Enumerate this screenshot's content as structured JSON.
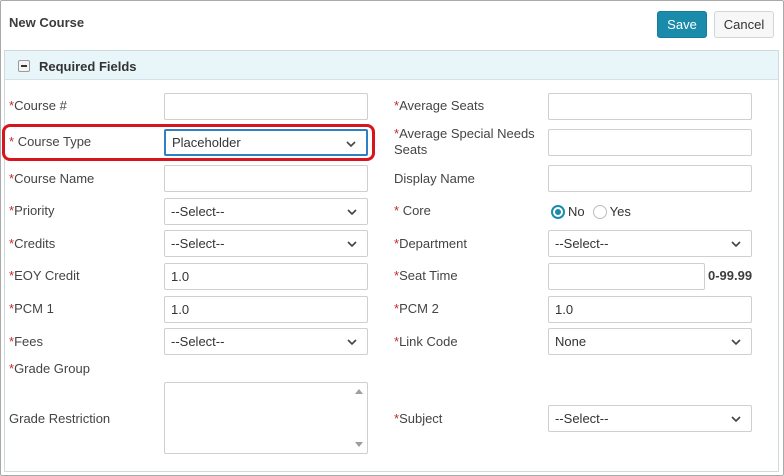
{
  "header": {
    "title": "New Course",
    "save_label": "Save",
    "cancel_label": "Cancel"
  },
  "section": {
    "title": "Required Fields"
  },
  "fields": {
    "course_number": {
      "label": "Course #",
      "value": ""
    },
    "course_type": {
      "label": "Course Type",
      "value": "Placeholder"
    },
    "course_name": {
      "label": "Course Name",
      "value": ""
    },
    "priority": {
      "label": "Priority",
      "value": "--Select--"
    },
    "credits": {
      "label": "Credits",
      "value": "--Select--"
    },
    "eoy_credit": {
      "label": "EOY Credit",
      "value": "1.0"
    },
    "pcm1": {
      "label": "PCM 1",
      "value": "1.0"
    },
    "fees": {
      "label": "Fees",
      "value": "--Select--"
    },
    "grade_group": {
      "label": "Grade Group"
    },
    "grade_restriction": {
      "label": "Grade Restriction",
      "value": ""
    },
    "average_seats": {
      "label": "Average Seats",
      "value": ""
    },
    "average_special_needs_seats": {
      "label_line1": "Average Special Needs",
      "label_line2": "Seats",
      "value": ""
    },
    "display_name": {
      "label": "Display Name",
      "value": ""
    },
    "core": {
      "label": "Core",
      "options": [
        "No",
        "Yes"
      ],
      "selected": "No"
    },
    "department": {
      "label": "Department",
      "value": "--Select--"
    },
    "seat_time": {
      "label": "Seat Time",
      "value": "",
      "hint": "0-99.99"
    },
    "pcm2": {
      "label": "PCM 2",
      "value": "1.0"
    },
    "link_code": {
      "label": "Link Code",
      "value": "None"
    },
    "subject": {
      "label": "Subject",
      "value": "--Select--"
    }
  },
  "required_marker": "*",
  "colors": {
    "accent": "#1a8bab",
    "required": "#c62828",
    "highlight": "#d7161c",
    "header_bg": "#e8f6f9"
  }
}
